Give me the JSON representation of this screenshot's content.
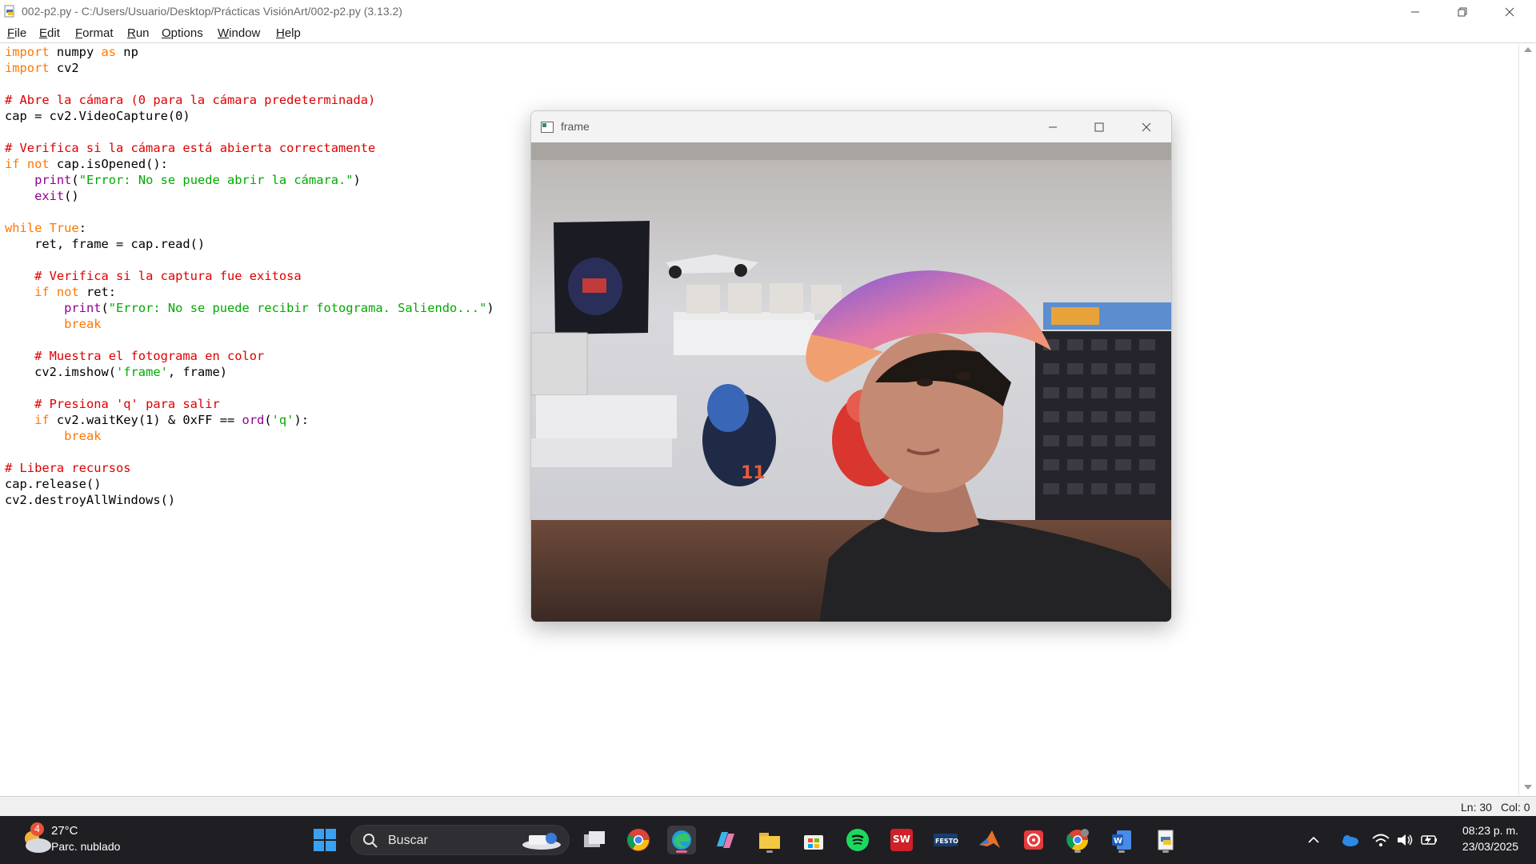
{
  "window": {
    "title": "002-p2.py - C:/Users/Usuario/Desktop/Prácticas VisiónArt/002-p2.py (3.13.2)"
  },
  "menu": [
    "File",
    "Edit",
    "Format",
    "Run",
    "Options",
    "Window",
    "Help"
  ],
  "code_lines": [
    "import numpy as np",
    "import cv2",
    "",
    "# Abre la cámara (0 para la cámara predeterminada)",
    "cap = cv2.VideoCapture(0)",
    "",
    "# Verifica si la cámara está abierta correctamente",
    "if not cap.isOpened():",
    "    print(\"Error: No se puede abrir la cámara.\")",
    "    exit()",
    "",
    "while True:",
    "    ret, frame = cap.read()",
    "",
    "    # Verifica si la captura fue exitosa",
    "    if not ret:",
    "        print(\"Error: No se puede recibir fotograma. Saliendo...\")",
    "        break",
    "",
    "    # Muestra el fotograma en color",
    "    cv2.imshow('frame', frame)",
    "",
    "    # Presiona 'q' para salir",
    "    if cv2.waitKey(1) & 0xFF == ord('q'):",
    "        break",
    "",
    "# Libera recursos",
    "cap.release()",
    "cv2.destroyAllWindows()"
  ],
  "status": {
    "line": "Ln: 30",
    "col": "Col: 0"
  },
  "frame_window": {
    "title": "frame",
    "content": "webcam-photo"
  },
  "taskbar": {
    "weather": {
      "badge": "4",
      "temp": "27°C",
      "desc": "Parc. nublado"
    },
    "search_placeholder": "Buscar",
    "apps": [
      "start-icon",
      "task-view-icon",
      "chrome-icon",
      "edge-icon",
      "copilot-icon",
      "file-explorer-icon",
      "microsoft-store-icon",
      "spotify-icon",
      "solidworks-icon",
      "festo-icon",
      "matlab-icon",
      "app-icon",
      "chrome-profile-icon",
      "word-icon",
      "python-idle-icon"
    ],
    "clock": {
      "time": "08:23 p. m.",
      "date": "23/03/2025"
    }
  },
  "colors": {
    "keyword": "#ff7700",
    "comment": "#dd0000",
    "builtin": "#900090",
    "string": "#00aa00",
    "taskbar": "#1f1f23"
  }
}
